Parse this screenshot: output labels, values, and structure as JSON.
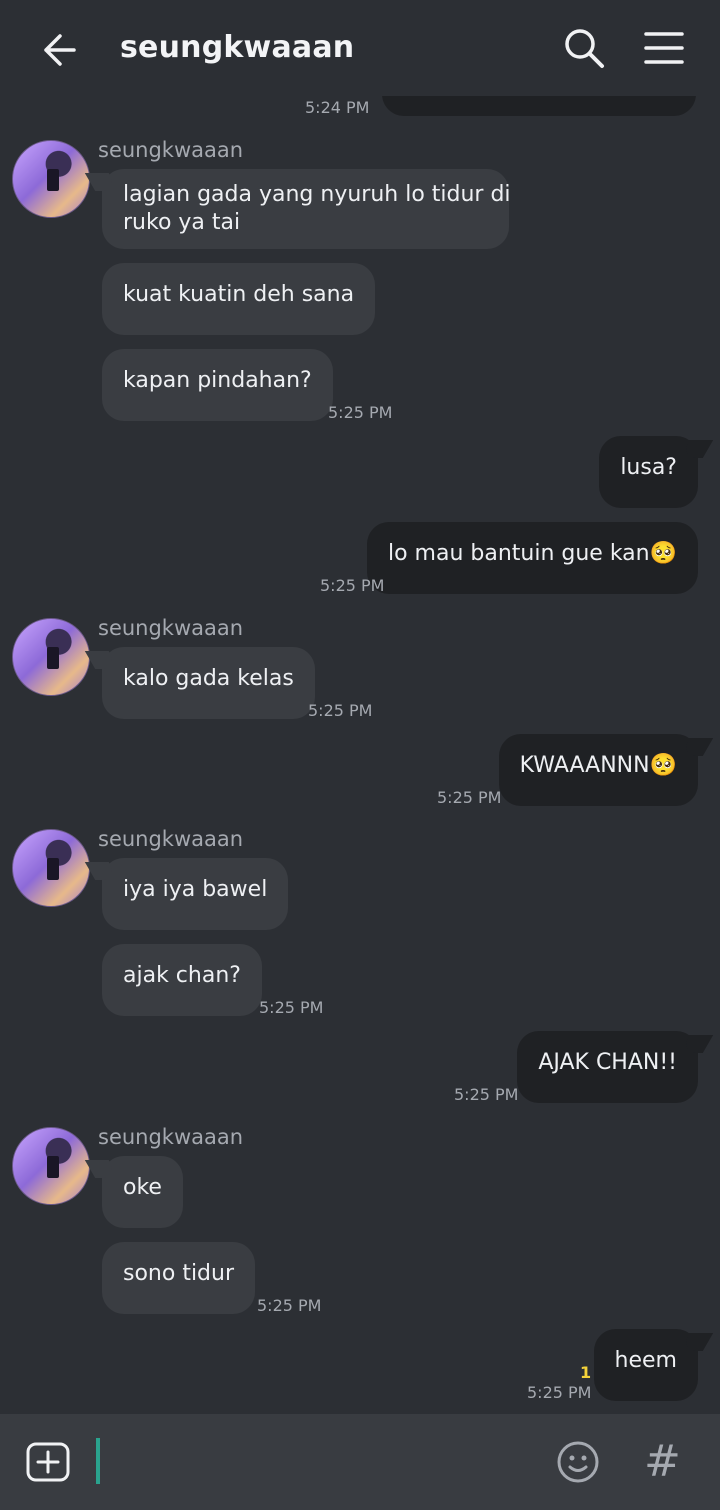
{
  "header": {
    "title": "seungkwaaan"
  },
  "messages": {
    "top_time": "5:24 PM",
    "g1": {
      "sender": "seungkwaaan",
      "m1": "lagian gada yang nyuruh lo tidur di",
      "m1b": "ruko ya tai",
      "m2": "kuat kuatin deh sana",
      "m3": "kapan pindahan?",
      "time": "5:25 PM"
    },
    "o1": {
      "m1": "lusa?",
      "m2": "lo mau bantuin gue kan🥺",
      "time": "5:25 PM"
    },
    "g2": {
      "sender": "seungkwaaan",
      "m1": "kalo gada kelas",
      "time": "5:25 PM"
    },
    "o2": {
      "m1": "KWAAANNN🥺",
      "time": "5:25 PM"
    },
    "g3": {
      "sender": "seungkwaaan",
      "m1": "iya iya bawel",
      "m2": "ajak chan?",
      "time": "5:25 PM"
    },
    "o3": {
      "m1": "AJAK CHAN!!",
      "time": "5:25 PM"
    },
    "g4": {
      "sender": "seungkwaaan",
      "m1": "oke",
      "m2": "sono tidur",
      "time": "5:25 PM"
    },
    "o4": {
      "m1": "heem",
      "time": "5:25 PM",
      "unread": "1"
    }
  },
  "icons": {
    "back": "back-arrow-icon",
    "search": "search-icon",
    "menu": "hamburger-menu-icon",
    "plus": "plus-icon",
    "emoji": "emoji-icon",
    "hash": "hash-icon"
  },
  "composer": {
    "hash_glyph": "#"
  }
}
